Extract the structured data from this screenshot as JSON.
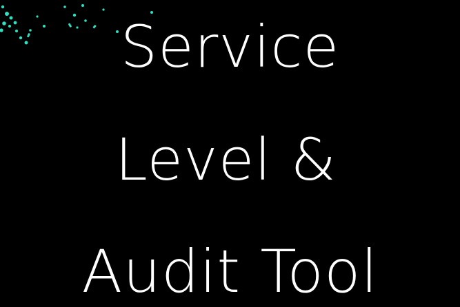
{
  "title": {
    "lines": [
      "Service",
      "Level &",
      "Audit Tool"
    ]
  },
  "colors": {
    "background": "#000000",
    "text": "#ffffff",
    "accent": "#2de0c0"
  },
  "decoration": {
    "icon": "scattered-confetti-dots"
  }
}
